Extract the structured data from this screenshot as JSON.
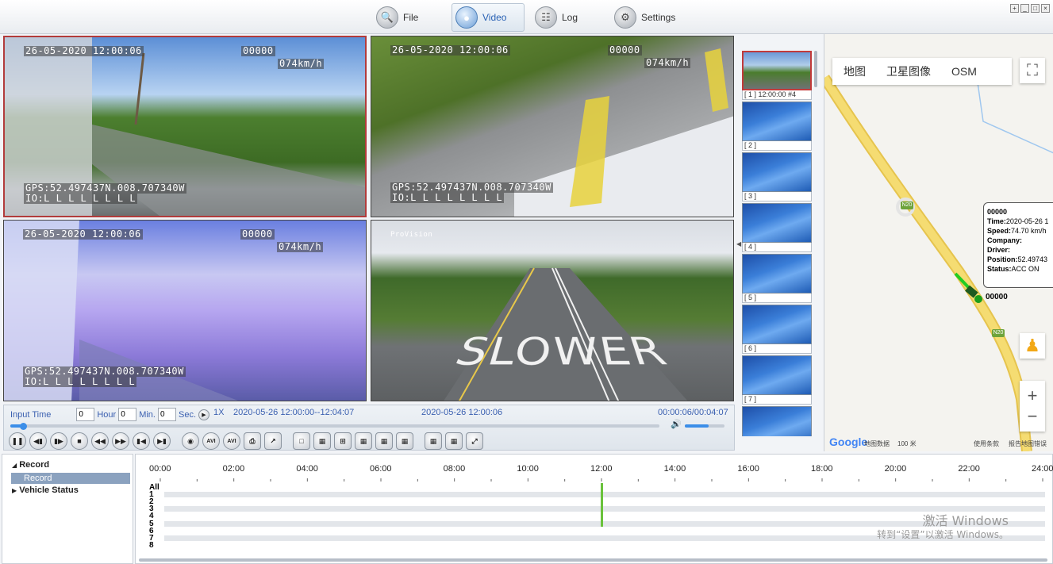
{
  "toolbar": {
    "tabs": [
      {
        "label": "File",
        "icon": "magnifier-icon"
      },
      {
        "label": "Video",
        "icon": "video-icon",
        "active": true
      },
      {
        "label": "Log",
        "icon": "log-icon"
      },
      {
        "label": "Settings",
        "icon": "gear-icon"
      }
    ]
  },
  "cameras": [
    {
      "date": "26-05-2020 12:00:06",
      "id": "00000",
      "speed": "074km/h",
      "gps": "GPS:52.497437N.008.707340W",
      "io": "IO:L L L L L L L L"
    },
    {
      "date": "26-05-2020 12:00:06",
      "id": "00000",
      "speed": "074km/h",
      "gps": "GPS:52.497437N.008.707340W",
      "io": "IO:L L L L L L L L"
    },
    {
      "date": "26-05-2020 12:00:06",
      "id": "00000",
      "speed": "074km/h",
      "gps": "GPS:52.497437N.008.707340W",
      "io": "IO:L L L L L L L L"
    },
    {
      "brand": "ProVision",
      "road_text": "SLOWER"
    }
  ],
  "controls": {
    "input_time_label": "Input Time",
    "hour_value": "0",
    "hour_label": "Hour",
    "min_value": "0",
    "min_label": "Min.",
    "sec_value": "0",
    "sec_label": "Sec.",
    "speed": "1X",
    "range": "2020-05-26 12:00:00--12:04:07",
    "current": "2020-05-26 12:00:06",
    "elapsed": "00:00:06/00:04:07",
    "progress": 0.02,
    "volume": 0.6
  },
  "thumbnails": [
    "[ 1 ] 12:00:00 #4",
    "[ 2 ]",
    "[ 3 ]",
    "[ 4 ]",
    "[ 5 ]",
    "[ 6 ]",
    "[ 7 ]",
    ""
  ],
  "map": {
    "tabs": [
      "地图",
      "卫星图像",
      "OSM"
    ],
    "road_badge": "N20",
    "info": {
      "id": "00000",
      "time_label": "Time:",
      "time": "2020-05-26 1",
      "speed_label": "Speed:",
      "speed": "74.70 km/h",
      "company_label": "Company:",
      "driver_label": "Driver:",
      "position_label": "Position:",
      "position": "52.49743",
      "status_label": "Status:",
      "status": "ACC ON"
    },
    "vehicle_label": "00000",
    "footer_logo": "Google",
    "footer_data": "地图数据",
    "footer_scale": "100 米",
    "footer_terms": "使用条款",
    "footer_report": "报告地图错误"
  },
  "tree": {
    "record": "Record",
    "record_child": "Record",
    "vehicle_status": "Vehicle Status"
  },
  "timeline": {
    "hours": [
      "00:00",
      "02:00",
      "04:00",
      "06:00",
      "08:00",
      "10:00",
      "12:00",
      "14:00",
      "16:00",
      "18:00",
      "20:00",
      "22:00",
      "24:00"
    ],
    "rows": [
      "All",
      "1",
      "2",
      "3",
      "4",
      "5",
      "6",
      "7",
      "8"
    ],
    "marker_hour": 12.0
  },
  "watermark": {
    "line1": "激活 Windows",
    "line2": "转到“设置”以激活 Windows。"
  },
  "colors": {
    "accent": "#3a5fb0",
    "selected_border": "#b23b3b",
    "record_marker": "#6ac23c",
    "route": "#f0d060"
  }
}
